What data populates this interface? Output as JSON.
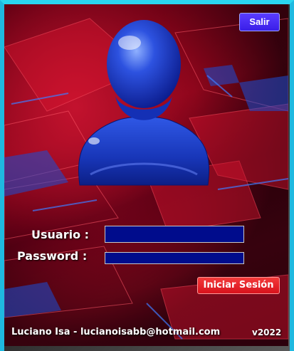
{
  "header": {
    "exit_label": "Salir"
  },
  "form": {
    "user_label": "Usuario :",
    "user_value": "",
    "password_label": "Password :",
    "password_value": "",
    "login_label": "Iniciar Sesión"
  },
  "footer": {
    "author": "Luciano Isa - lucianoisabb@hotmail.com",
    "version": "v2022"
  },
  "colors": {
    "frame": "#1fb9e0",
    "exit_button": "#4a2cf5",
    "login_button": "#e8222a",
    "input_bg": "#000c8c",
    "background": "#b00f27"
  },
  "icons": {
    "avatar": "user-avatar-icon"
  }
}
